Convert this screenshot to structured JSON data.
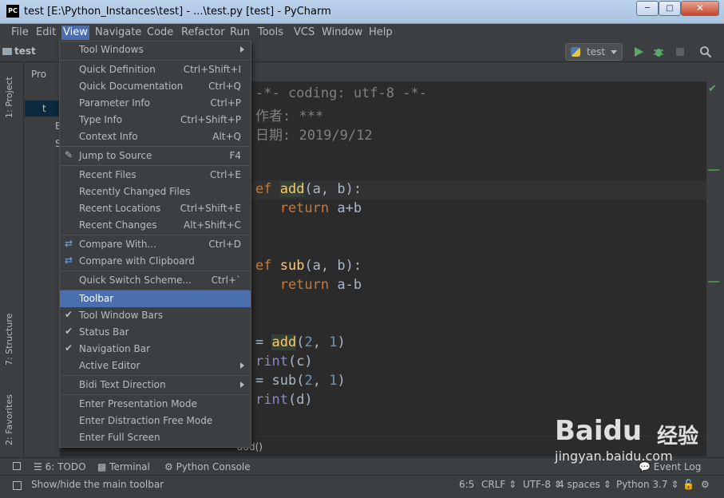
{
  "window": {
    "title": "test [E:\\Python_Instances\\test] - ...\\test.py [test] - PyCharm",
    "logo": "PC"
  },
  "menubar": [
    "File",
    "Edit",
    "View",
    "Navigate",
    "Code",
    "Refactor",
    "Run",
    "Tools",
    "VCS",
    "Window",
    "Help"
  ],
  "navbar": {
    "project": "test",
    "run_config": "test"
  },
  "sidebar_tabs": {
    "project": "1: Project",
    "structure": "7: Structure",
    "favorites": "2: Favorites"
  },
  "project_panel": {
    "header": "Pro",
    "rows": [
      "t",
      "E",
      "S"
    ]
  },
  "view_menu": {
    "items": [
      {
        "label": "Tool Windows",
        "shortcut": "",
        "submenu": true
      },
      {
        "label": "Quick Definition",
        "shortcut": "Ctrl+Shift+I"
      },
      {
        "label": "Quick Documentation",
        "shortcut": "Ctrl+Q"
      },
      {
        "label": "Parameter Info",
        "shortcut": "Ctrl+P"
      },
      {
        "label": "Type Info",
        "shortcut": "Ctrl+Shift+P"
      },
      {
        "label": "Context Info",
        "shortcut": "Alt+Q"
      },
      {
        "label": "Jump to Source",
        "shortcut": "F4",
        "icon": "pencil-icon"
      },
      {
        "label": "Recent Files",
        "shortcut": "Ctrl+E"
      },
      {
        "label": "Recently Changed Files",
        "shortcut": ""
      },
      {
        "label": "Recent Locations",
        "shortcut": "Ctrl+Shift+E"
      },
      {
        "label": "Recent Changes",
        "shortcut": "Alt+Shift+C"
      },
      {
        "label": "Compare With...",
        "shortcut": "Ctrl+D",
        "icon": "compare-icon"
      },
      {
        "label": "Compare with Clipboard",
        "shortcut": "",
        "icon": "clipboard-compare-icon"
      },
      {
        "label": "Quick Switch Scheme...",
        "shortcut": "Ctrl+`"
      },
      {
        "label": "Toolbar",
        "shortcut": "",
        "highlighted": true
      },
      {
        "label": "Tool Window Bars",
        "shortcut": "",
        "checked": true
      },
      {
        "label": "Status Bar",
        "shortcut": "",
        "checked": true
      },
      {
        "label": "Navigation Bar",
        "shortcut": "",
        "checked": true
      },
      {
        "label": "Active Editor",
        "shortcut": "",
        "submenu": true
      },
      {
        "label": "Bidi Text Direction",
        "shortcut": "",
        "submenu": true
      },
      {
        "label": "Enter Presentation Mode",
        "shortcut": ""
      },
      {
        "label": "Enter Distraction Free Mode",
        "shortcut": ""
      },
      {
        "label": "Enter Full Screen",
        "shortcut": ""
      }
    ]
  },
  "code": {
    "lines": [
      {
        "text": "-*- coding: utf-8 -*-"
      },
      {
        "text": "作者: ***"
      },
      {
        "text": "日期: 2019/9/12"
      },
      {
        "kw": "ef ",
        "fn": "add",
        "rest": "(a, b):"
      },
      {
        "kw": "   return ",
        "rest": "a+b"
      },
      {
        "kw": "ef ",
        "fn": "sub",
        "rest": "(a, b):"
      },
      {
        "kw": "   return ",
        "rest": "a-b"
      },
      {
        "pre": "= ",
        "fn": "add",
        "rest": "(",
        "num1": "2",
        "mid": ", ",
        "num2": "1",
        "end": ")"
      },
      {
        "builtin": "rint",
        "rest": "(c)"
      },
      {
        "pre": "= ",
        "plain": "sub",
        "rest": "(",
        "num1": "2",
        "mid": ", ",
        "num2": "1",
        "end": ")"
      },
      {
        "builtin": "rint",
        "rest": "(d)"
      }
    ],
    "breadcrumb": "add()"
  },
  "bottom_tools": {
    "todo": "6: TODO",
    "terminal": "Terminal",
    "console": "Python Console",
    "event_log": "Event Log"
  },
  "status": {
    "message": "Show/hide the main toolbar",
    "position": "6:5",
    "line_sep": "CRLF",
    "encoding": "UTF-8",
    "indent": "4 spaces",
    "interpreter": "Python 3.7"
  },
  "watermark": {
    "brand": "Baidu",
    "sub": "经验",
    "url": "jingyan.baidu.com"
  },
  "colors": {
    "accent": "#4b6eaf",
    "background": "#3c3f41",
    "editor": "#2b2b2b"
  }
}
